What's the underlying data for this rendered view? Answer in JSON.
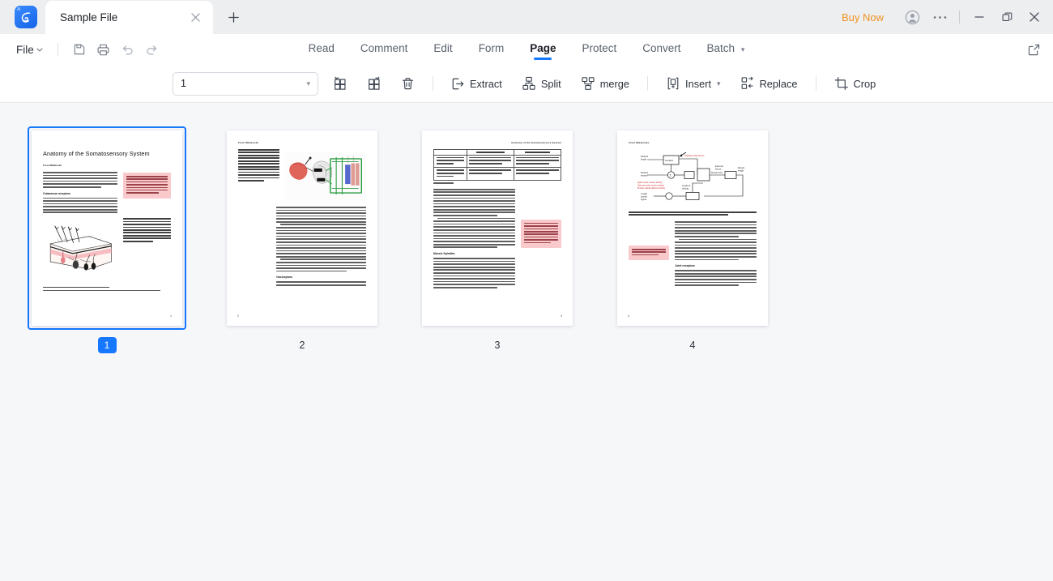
{
  "app": {
    "logo_icon": "pdf-app-logo-icon",
    "logo_badge": "AI"
  },
  "titlebar": {
    "tab": {
      "title": "Sample File",
      "close_icon": "close-icon"
    },
    "new_tab_icon": "plus-icon",
    "buy_now": "Buy Now",
    "account_icon": "account-avatar-icon",
    "more_icon": "more-options-icon",
    "minimize_icon": "minimize-icon",
    "maximize_icon": "maximize-icon",
    "close_icon": "window-close-icon"
  },
  "navbar": {
    "file_label": "File",
    "file_chevron": "chevron-down-icon",
    "quick_icons": [
      {
        "name": "save-icon"
      },
      {
        "name": "print-icon"
      },
      {
        "name": "undo-icon"
      },
      {
        "name": "redo-icon"
      }
    ],
    "tabs": [
      {
        "label": "Read",
        "active": false
      },
      {
        "label": "Comment",
        "active": false
      },
      {
        "label": "Edit",
        "active": false
      },
      {
        "label": "Form",
        "active": false
      },
      {
        "label": "Page",
        "active": true
      },
      {
        "label": "Protect",
        "active": false
      },
      {
        "label": "Convert",
        "active": false
      },
      {
        "label": "Batch",
        "active": false,
        "chevron": true
      }
    ],
    "share_icon": "external-link-icon"
  },
  "toolbar": {
    "page_select": {
      "value": "1",
      "chevron": "chevron-down-icon"
    },
    "rotate_left": {
      "label": "",
      "icon": "rotate-left-icon"
    },
    "rotate_right": {
      "label": "",
      "icon": "rotate-right-icon"
    },
    "delete": {
      "label": "",
      "icon": "trash-icon"
    },
    "extract": {
      "label": "Extract",
      "icon": "extract-icon"
    },
    "split": {
      "label": "Split",
      "icon": "split-icon"
    },
    "merge": {
      "label": "merge",
      "icon": "merge-icon"
    },
    "insert": {
      "label": "Insert",
      "icon": "insert-icon",
      "chevron": "chevron-down-icon"
    },
    "replace": {
      "label": "Replace",
      "icon": "replace-icon"
    },
    "crop": {
      "label": "Crop",
      "icon": "crop-icon"
    }
  },
  "colors": {
    "accent": "#1677ff",
    "buy_now": "#f0921f",
    "workspace_bg": "#f6f7f9",
    "titlebar_bg": "#edeef0",
    "highlight_box": "#f9c9cc"
  },
  "pages": [
    {
      "number": "1",
      "selected": true,
      "title": "Anatomy of the Somatosensory System",
      "byline": "From Wikibooks",
      "section": "Cutaneous receptors",
      "note_text": "This is a sample document to showcase page-based formatting. It contains a chapter from a Wikibook called Sensory Systems. None of the content has been changed in this article, but some content has been removed.",
      "figure_caption": "Figure 1: Receptors in the human skin: Mechanoreceptors can be free receptors or encapsulated. Examples for free receptors are the hair receptors at the roots of hairs. Encapsulated receptors are the Pacinian corpuscles and the receptors in the glabrous (hairless) skin: Meissner corpuscles, Ruffini corpuscles and Merkel's disks.",
      "footnote": "The following description is based on lecture notes from Laszlo Zaborszky, from Rutgers University."
    },
    {
      "number": "2",
      "selected": false,
      "byline": "From Wikibooks",
      "figure_caption": "Figure 2: Mammalian muscle spindle showing typical position in a muscle (left), neuronal connections in spinal cord and (middle) and expanded schematic (right). The spindle is a stretch receptor with its own motor supply consisting of several intrafusal muscle fibres. The sensory endings of a primary group Ia afferent and a secondary group II afferent coil around the non-contractile central portions of the intrafusal fibres.",
      "section": "Nociceptors"
    },
    {
      "number": "3",
      "selected": false,
      "header": "Anatomy of the Somatosensory System",
      "table_headers": [
        "",
        "Rapidly adapting",
        "Slowly adapting"
      ],
      "table_rows": [
        [
          "Surface receptor / small receptive field",
          "Hair receptor, Meissner's corpuscle: Detect an immediate or very fine vibration. Used for recognizing texture.",
          "Merkel's receptor: Used for spatial details, e.g. a round surface edge or \"an X\" in brail."
        ],
        [
          "Deep receptor / large receptive field",
          "Pacinian corpuscle: \"A diffuse vibration\" e.g. tapping with a pencil.",
          "Ruffini's corpuscle: \"A skin stretch\". Used for joint position in fingers."
        ]
      ],
      "table_caption": "Table 1",
      "note_text": "Notice how figure captions and references are placed in the outside margin (on the left or right), depending on whether the page is left or right). Also, figures are floated to the top/bottom of the page. Wide content, like the table and Figure 2, intrude into the outside margins.",
      "section": "Muscle Spindles"
    },
    {
      "number": "4",
      "selected": false,
      "byline": "From Wikibooks",
      "figure_annotation_1": "Inhibitory interneuron",
      "figure_annotation_2": "Length control signal; Length & velocity signal",
      "figure_caption": "Figure 3: Feedback loops for proprioceptive signals for the perception and control of limb movements. Arrows indicate excitatory connections; filled circles inhibitory connections.",
      "note_text": "For more examples of how to use HTML and CSS for paper-based publishing, see cert.pub.",
      "section": "Joint receptors"
    }
  ]
}
